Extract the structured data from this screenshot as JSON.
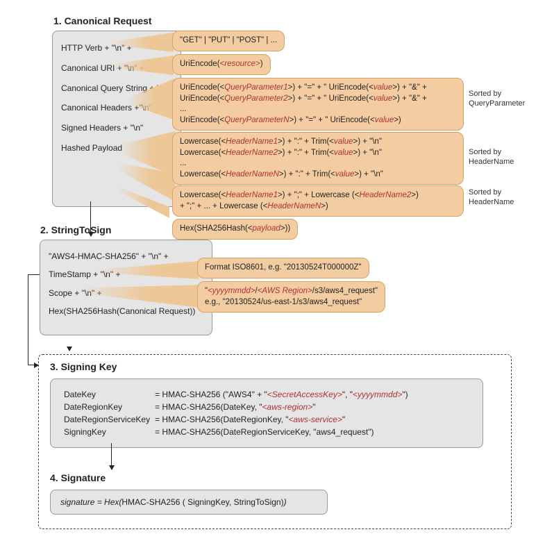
{
  "sections": {
    "canonical": {
      "title": "1. Canonical Request",
      "rows": {
        "verb": "HTTP Verb + \"\\n\" +",
        "uri": "Canonical URI + \"\\n\" +",
        "query": "Canonical Query String + \"\\n\"",
        "headers": "Canonical Headers +\"\\n\"",
        "signed": "Signed Headers + \"\\n\"",
        "payload": "Hashed Payload"
      }
    },
    "string_to_sign": {
      "title": "2. StringToSign",
      "rows": {
        "alg": "\"AWS4-HMAC-SHA256\" + \"\\n\" +",
        "ts": "TimeStamp + \"\\n\" +",
        "scope": "Scope + \"\\n\" +",
        "hash": "Hex(SHA256Hash(Canonical Request))"
      }
    },
    "signing_key": {
      "title": "3. Signing Key",
      "rows": {
        "date_key_l": "DateKey",
        "date_key_r_pre": "= HMAC-SHA256 (\"AWS4\" + \"",
        "date_key_r_red1": "<SecretAccessKey>",
        "date_key_r_mid": "\", \"",
        "date_key_r_red2": "<yyyymmdd>",
        "date_key_r_post": "\")",
        "date_region_l": "DateRegionKey",
        "date_region_r_pre": "= HMAC-SHA256(DateKey, \"",
        "date_region_r_red": "<aws-region>",
        "date_region_r_post": "\"",
        "date_region_svc_l": "DateRegionServiceKey",
        "date_region_svc_r_pre": "= HMAC-SHA256(DateRegionKey, \"",
        "date_region_svc_r_red": "<aws-service>",
        "date_region_svc_r_post": "\"",
        "signing_l": "SigningKey",
        "signing_r": "= HMAC-SHA256(DateRegionServiceKey, \"aws4_request\")"
      }
    },
    "signature": {
      "title": "4. Signature",
      "line_pre": "signature =   Hex(",
      "line_mid": "HMAC-SHA256 ( SigningKey, StringToSign)",
      "line_post": ")"
    }
  },
  "callouts": {
    "verb": "\"GET\" | \"PUT\" | \"POST\" | ...",
    "uri_pre": "UriEncode(",
    "uri_red": "<resource>",
    "uri_post": ")",
    "query_block": {
      "l1a": "UriEncode(<",
      "l1b": "QueryParameter1",
      "l1c": ">) + \"=\" + \" UriEncode(<",
      "l1d": "value",
      "l1e": ">) + \"&\" +",
      "l2a": "UriEncode(<",
      "l2b": "QueryParameter2",
      "l2c": ">) + \"=\" + \" UriEncode(<",
      "l2d": "value",
      "l2e": ">) + \"&\" +",
      "dots": "...",
      "l3a": "UriEncode(<",
      "l3b": "QueryParameterN",
      "l3c": ">) + \"=\" + \" UriEncode(<",
      "l3d": "value",
      "l3e": ">)"
    },
    "headers_block": {
      "l1a": "Lowercase(<",
      "l1b": "HeaderName1",
      "l1c": ">) + \":\" + Trim(<",
      "l1d": "value",
      "l1e": ">) + \"\\n\"",
      "l2a": "Lowercase(<",
      "l2b": "HeaderName2",
      "l2c": ">) + \":\" + Trim(<",
      "l2d": "value",
      "l2e": ">) + \"\\n\"",
      "dots": "...",
      "l3a": "Lowercase(<",
      "l3b": "HeaderNameN",
      "l3c": ">) + \":\" + Trim(<",
      "l3d": "value",
      "l3e": ">) + \"\\n\""
    },
    "signed_block": {
      "l1a": "Lowercase(<",
      "l1b": "HeaderName1",
      "l1c": ">) + \";\" + Lowercase (<",
      "l1d": "HeaderName2",
      "l1e": ">)",
      "l2a": "+ \";\" + ... + Lowercase (<",
      "l2b": "HeaderNameN",
      "l2c": ">)"
    },
    "hash_pre": "Hex(SHA256Hash(<",
    "hash_red": "payload",
    "hash_post": ">))",
    "ts": "Format ISO8601,  e.g. \"20130524T000000Z\"",
    "scope_l1a": "\"",
    "scope_l1b": "<yyyymmdd>",
    "scope_l1c": "/",
    "scope_l1d": "<AWS Region>",
    "scope_l1e": "/s3/aws4_request\"",
    "scope_l2": "e.g., \"20130524/us-east-1/s3/aws4_request\""
  },
  "side_labels": {
    "qp": "Sorted by\nQueryParameter",
    "hn1": "Sorted by\nHeaderName",
    "hn2": "Sorted by\nHeaderName"
  }
}
